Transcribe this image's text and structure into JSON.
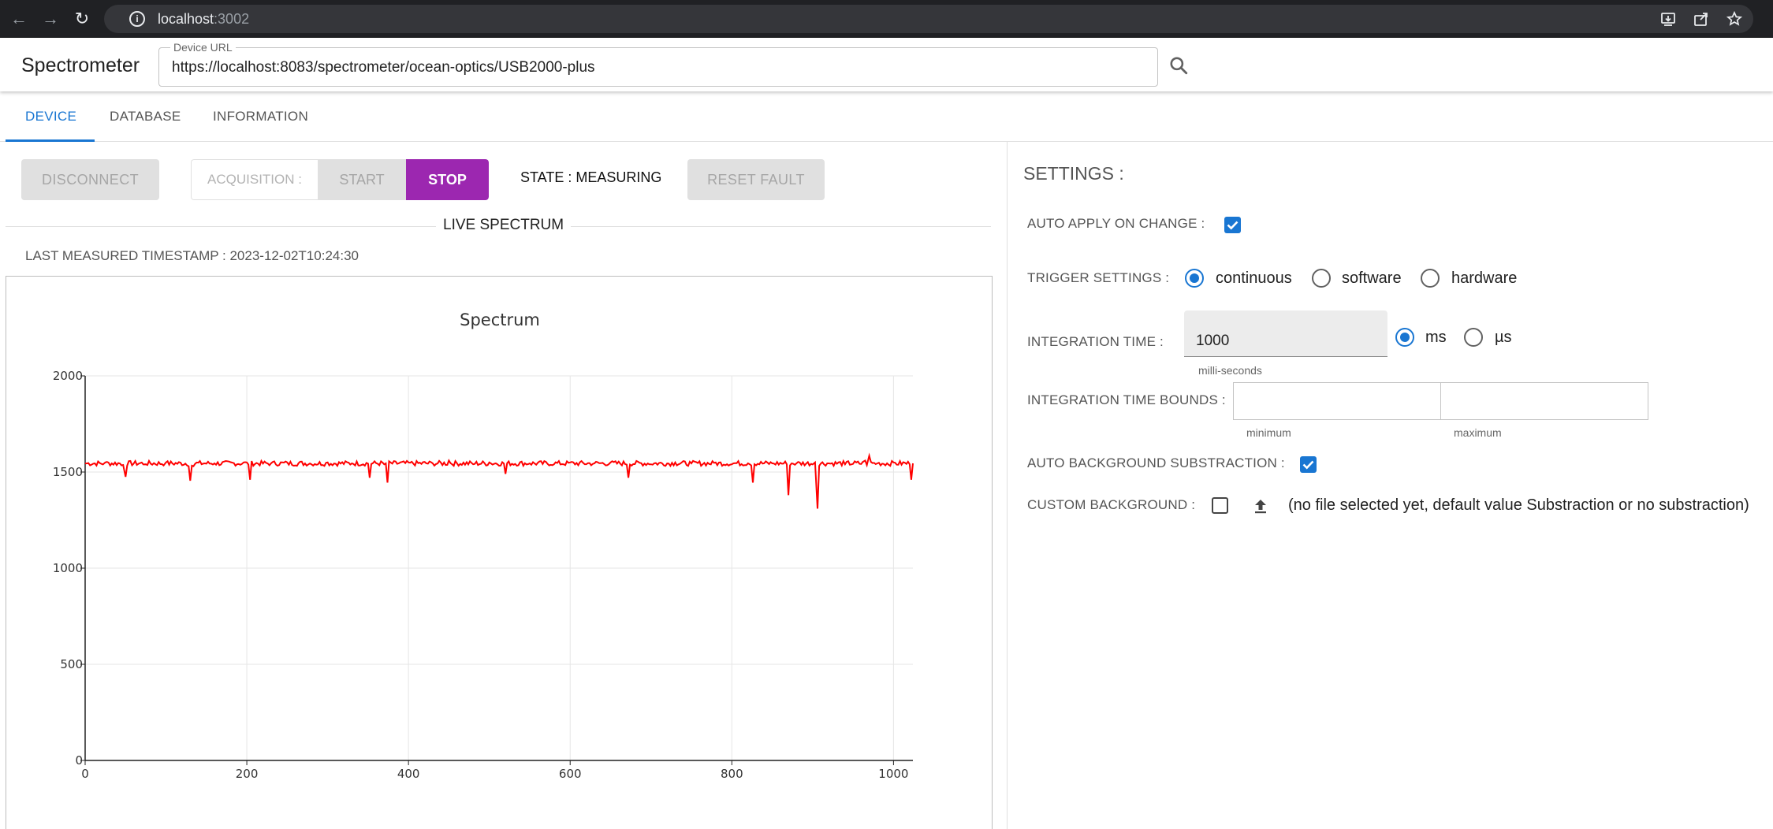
{
  "browser": {
    "host": "localhost",
    "port": ":3002"
  },
  "app": {
    "title": "Spectrometer",
    "device_url_label": "Device URL",
    "device_url_value": "https://localhost:8083/spectrometer/ocean-optics/USB2000-plus"
  },
  "tabs": [
    {
      "label": "DEVICE",
      "active": true
    },
    {
      "label": "DATABASE",
      "active": false
    },
    {
      "label": "INFORMATION",
      "active": false
    }
  ],
  "controls": {
    "disconnect_label": "DISCONNECT",
    "acquisition_label": "ACQUISITION :",
    "start_label": "START",
    "stop_label": "STOP",
    "state_text": "STATE : MEASURING",
    "reset_fault_label": "RESET FAULT"
  },
  "live": {
    "section_title": "LIVE SPECTRUM",
    "timestamp_text": "LAST MEASURED TIMESTAMP : 2023-12-02T10:24:30"
  },
  "settings": {
    "title": "SETTINGS :",
    "auto_apply_label": "AUTO APPLY ON CHANGE :",
    "auto_apply_checked": true,
    "trigger_label": "TRIGGER SETTINGS :",
    "trigger_options": [
      "continuous",
      "software",
      "hardware"
    ],
    "trigger_selected": "continuous",
    "integration_time_label": "INTEGRATION TIME :",
    "integration_time_value": "1000",
    "integration_time_helper": "milli-seconds",
    "integration_unit_options": [
      "ms",
      "µs"
    ],
    "integration_unit_selected": "ms",
    "bounds_label": "INTEGRATION TIME BOUNDS :",
    "bounds_min_helper": "minimum",
    "bounds_max_helper": "maximum",
    "bounds_min_value": "",
    "bounds_max_value": "",
    "auto_bg_label": "AUTO BACKGROUND SUBSTRACTION :",
    "auto_bg_checked": true,
    "custom_bg_label": "CUSTOM BACKGROUND :",
    "custom_bg_checked": false,
    "custom_bg_text": "(no file selected yet, default value Substraction or no substraction)"
  },
  "colors": {
    "accent": "#1976d2",
    "stop_button": "#9c27b0",
    "series": "#ff0000"
  },
  "chart_data": {
    "type": "line",
    "title": "Spectrum",
    "xlabel": "",
    "ylabel": "",
    "xlim": [
      0,
      1024
    ],
    "ylim": [
      0,
      2000
    ],
    "xticks": [
      0,
      200,
      400,
      600,
      800,
      1000
    ],
    "yticks": [
      0,
      500,
      1000,
      1500,
      2000
    ],
    "grid": true,
    "series": [
      {
        "color": "#ff0000",
        "x": [
          0,
          25,
          45,
          50,
          75,
          100,
          128,
          130,
          134,
          160,
          200,
          204,
          230,
          250,
          280,
          300,
          330,
          352,
          370,
          374,
          400,
          430,
          450,
          480,
          500,
          520,
          550,
          580,
          600,
          630,
          650,
          672,
          700,
          730,
          750,
          780,
          800,
          820,
          826,
          850,
          868,
          870,
          880,
          903,
          906,
          920,
          940,
          965,
          970,
          980,
          1000,
          1020,
          1022,
          1024
        ],
        "y": [
          1545,
          1550,
          1535,
          1475,
          1540,
          1550,
          1530,
          1455,
          1530,
          1545,
          1550,
          1460,
          1545,
          1550,
          1540,
          1550,
          1545,
          1470,
          1540,
          1445,
          1550,
          1545,
          1560,
          1540,
          1550,
          1490,
          1545,
          1540,
          1550,
          1545,
          1550,
          1470,
          1540,
          1550,
          1545,
          1550,
          1540,
          1545,
          1445,
          1545,
          1540,
          1380,
          1545,
          1550,
          1310,
          1545,
          1540,
          1560,
          1585,
          1545,
          1550,
          1540,
          1460,
          1545
        ]
      }
    ]
  }
}
